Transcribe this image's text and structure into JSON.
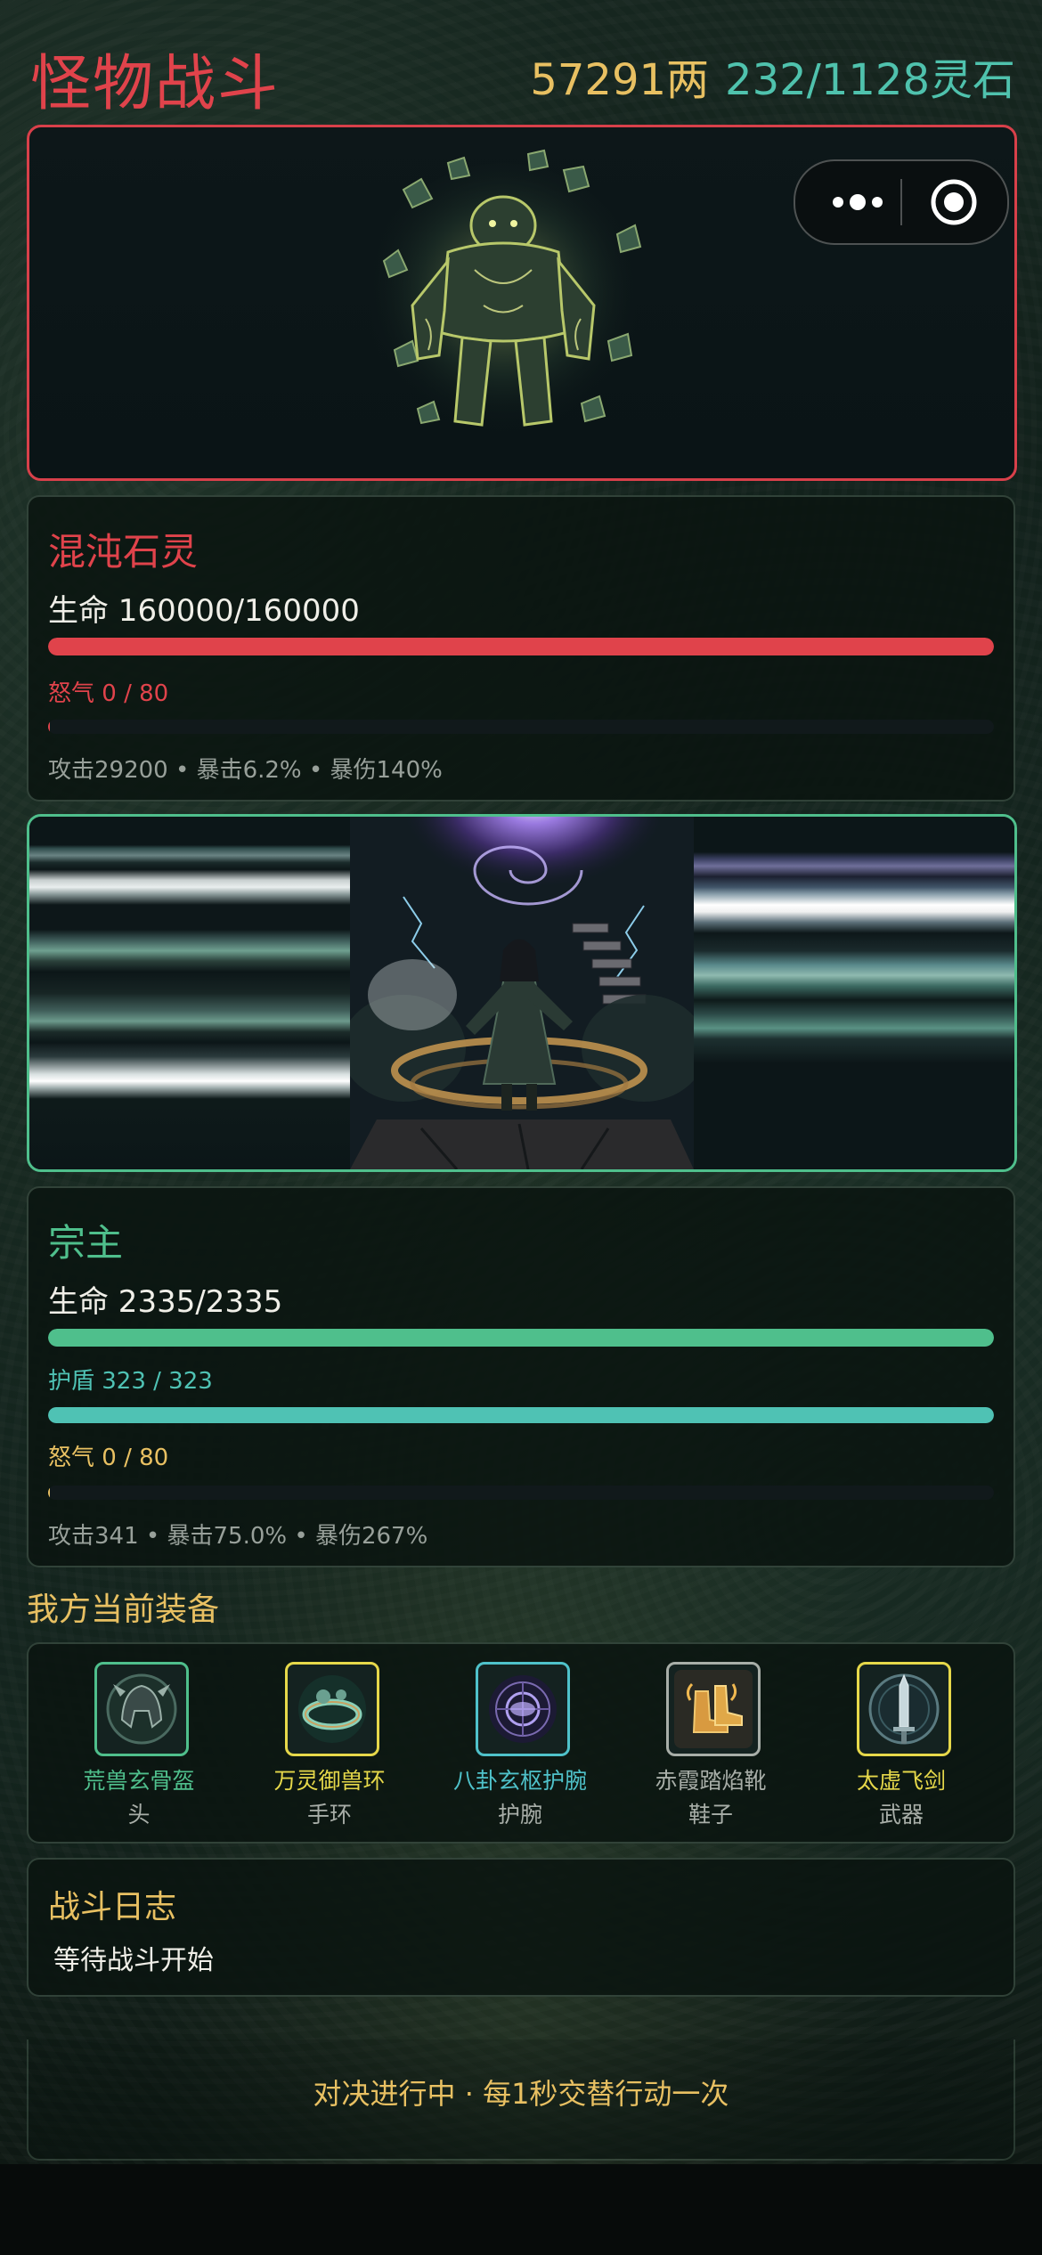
{
  "header": {
    "title": "怪物战斗",
    "gold": "57291两",
    "spirit_stone": "232/1128灵石"
  },
  "capsule": {
    "menu_icon": "more-dots-icon",
    "close_icon": "target-circle-icon"
  },
  "monster": {
    "name": "混沌石灵",
    "hp_text": "生命 160000/160000",
    "hp_fraction": 1.0,
    "rage_text": "怒气 0 / 80",
    "rage_fraction": 0.0,
    "stats": "攻击29200 • 暴击6.2% • 暴伤140%"
  },
  "hero": {
    "name": "宗主",
    "hp_text": "生命 2335/2335",
    "hp_fraction": 1.0,
    "shield_text": "护盾 323 / 323",
    "shield_fraction": 1.0,
    "rage_text": "怒气 0 / 80",
    "rage_fraction": 0.0,
    "stats": "攻击341 • 暴击75.0% • 暴伤267%"
  },
  "equipment": {
    "title": "我方当前装备",
    "items": [
      {
        "name": "荒兽玄骨盔",
        "slot": "头",
        "color": "#4fbf8c",
        "icon": "helmet-icon"
      },
      {
        "name": "万灵御兽环",
        "slot": "手环",
        "color": "#e6d84a",
        "icon": "bracelet-icon"
      },
      {
        "name": "八卦玄枢护腕",
        "slot": "护腕",
        "color": "#4fc2ca",
        "icon": "bagua-bracer-icon"
      },
      {
        "name": "赤霞踏焰靴",
        "slot": "鞋子",
        "color": "#a8aea8",
        "icon": "boots-icon"
      },
      {
        "name": "太虚飞剑",
        "slot": "武器",
        "color": "#e6d84a",
        "icon": "sword-icon"
      }
    ]
  },
  "log": {
    "title": "战斗日志",
    "line": "等待战斗开始"
  },
  "footer": {
    "status": "对决进行中 · 每1秒交替行动一次"
  },
  "colors": {
    "monster_accent": "#e0434b",
    "hero_accent": "#4fbf8c",
    "shield": "#4fc2b4",
    "gold": "#e8c062"
  }
}
